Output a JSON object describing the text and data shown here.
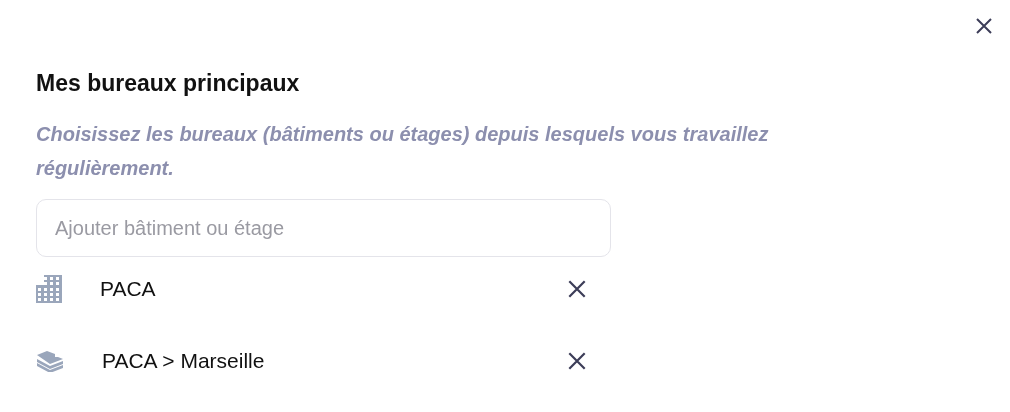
{
  "title": "Mes bureaux principaux",
  "description": "Choisissez les bureaux (bâtiments ou étages) depuis lesquels vous travaillez régulièrement.",
  "search": {
    "placeholder": "Ajouter bâtiment ou étage"
  },
  "offices": [
    {
      "kind": "building",
      "label": "PACA"
    },
    {
      "kind": "floor",
      "label": "PACA > Marseille"
    }
  ]
}
